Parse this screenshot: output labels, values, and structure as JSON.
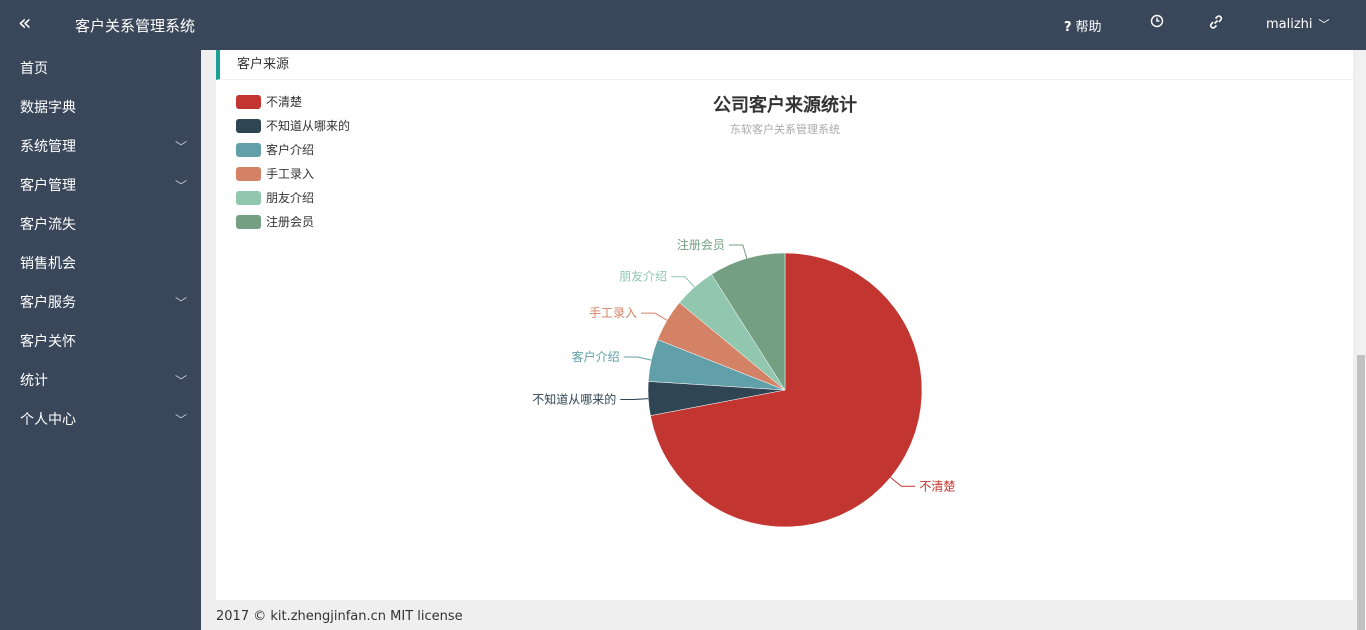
{
  "topbar": {
    "collapse_icon": "double-chevron-left-icon",
    "title": "客户关系管理系统",
    "help_symbol": "?",
    "help_label": "帮助",
    "clock_icon": "clock-icon",
    "link_icon": "link-icon",
    "username": "malizhi"
  },
  "sidebar": {
    "items": [
      {
        "label": "首页",
        "has_submenu": false
      },
      {
        "label": "数据字典",
        "has_submenu": false
      },
      {
        "label": "系统管理",
        "has_submenu": true
      },
      {
        "label": "客户管理",
        "has_submenu": true
      },
      {
        "label": "客户流失",
        "has_submenu": false
      },
      {
        "label": "销售机会",
        "has_submenu": false
      },
      {
        "label": "客户服务",
        "has_submenu": true
      },
      {
        "label": "客户关怀",
        "has_submenu": false
      },
      {
        "label": "统计",
        "has_submenu": true
      },
      {
        "label": "个人中心",
        "has_submenu": true
      }
    ]
  },
  "card": {
    "header": "客户来源"
  },
  "footer": {
    "text": "2017 © kit.zhengjinfan.cn MIT license"
  },
  "colors": {
    "topbar_bg": "#3a475a",
    "accent_border": "#1aa094"
  },
  "chart_data": {
    "type": "pie",
    "title": "公司客户来源统计",
    "subtitle": "东软客户关系管理系统",
    "legend_position": "top-left",
    "categories": [
      "不清楚",
      "不知道从哪来的",
      "客户介绍",
      "手工录入",
      "朋友介绍",
      "注册会员"
    ],
    "values": [
      72,
      4,
      5,
      5,
      5,
      9
    ],
    "colors": [
      "#c23531",
      "#2f4554",
      "#61a0a8",
      "#d48265",
      "#91c7ae",
      "#749f83"
    ]
  }
}
